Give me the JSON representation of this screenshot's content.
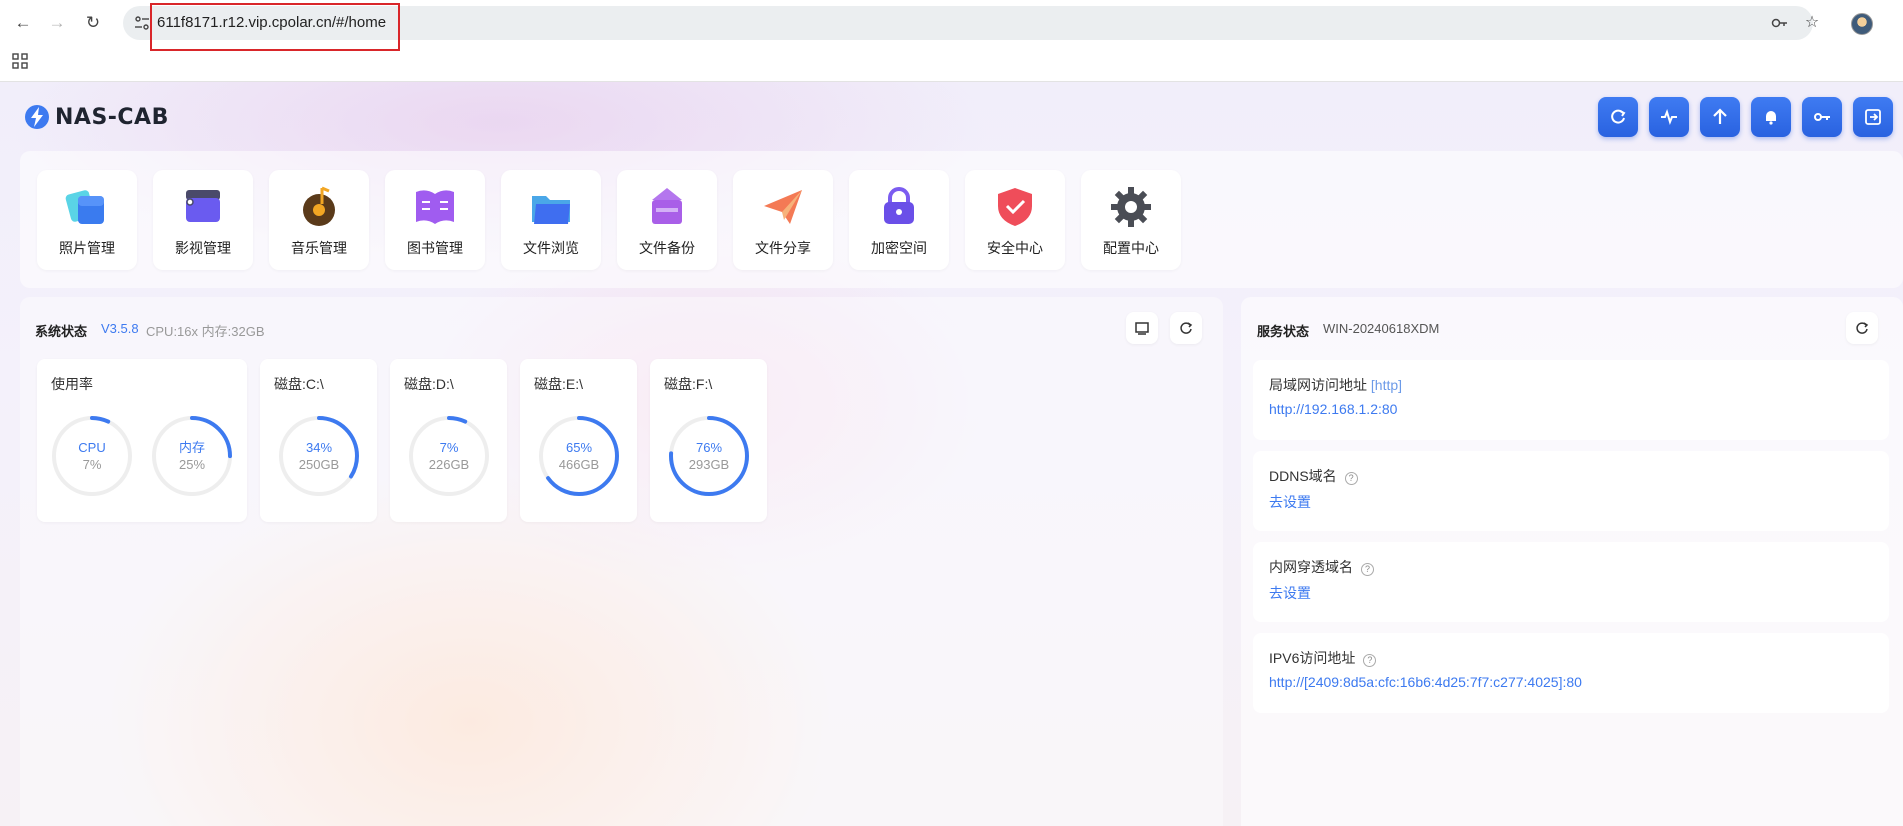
{
  "browser": {
    "url": "611f8171.r12.vip.cpolar.cn/#/home"
  },
  "app": {
    "logo_text": "NAS-CAB"
  },
  "apps": [
    {
      "label": "照片管理",
      "icon": "photo-icon"
    },
    {
      "label": "影视管理",
      "icon": "video-icon"
    },
    {
      "label": "音乐管理",
      "icon": "music-icon"
    },
    {
      "label": "图书管理",
      "icon": "book-icon"
    },
    {
      "label": "文件浏览",
      "icon": "folder-icon"
    },
    {
      "label": "文件备份",
      "icon": "backup-icon"
    },
    {
      "label": "文件分享",
      "icon": "share-icon"
    },
    {
      "label": "加密空间",
      "icon": "lock-icon"
    },
    {
      "label": "安全中心",
      "icon": "shield-icon"
    },
    {
      "label": "配置中心",
      "icon": "gear-icon"
    }
  ],
  "system": {
    "title": "系统状态",
    "version": "V3.5.8",
    "meta": "CPU:16x 内存:32GB",
    "usage_card": {
      "title": "使用率",
      "gauges": [
        {
          "label": "CPU",
          "value": "7%",
          "percent": 7
        },
        {
          "label": "内存",
          "value": "25%",
          "percent": 25
        }
      ]
    },
    "disks": [
      {
        "title": "磁盘:C:\\",
        "percent_label": "34%",
        "size": "250GB",
        "percent": 34
      },
      {
        "title": "磁盘:D:\\",
        "percent_label": "7%",
        "size": "226GB",
        "percent": 7
      },
      {
        "title": "磁盘:E:\\",
        "percent_label": "65%",
        "size": "466GB",
        "percent": 65
      },
      {
        "title": "磁盘:F:\\",
        "percent_label": "76%",
        "size": "293GB",
        "percent": 76
      }
    ]
  },
  "service": {
    "title": "服务状态",
    "host": "WIN-20240618XDM",
    "cards": [
      {
        "title": "局域网访问地址",
        "tag": "[http]",
        "value": "http://192.168.1.2:80",
        "help": false
      },
      {
        "title": "DDNS域名",
        "tag": "",
        "value": "去设置",
        "help": true
      },
      {
        "title": "内网穿透域名",
        "tag": "",
        "value": "去设置",
        "help": true
      },
      {
        "title": "IPV6访问地址",
        "tag": "",
        "value": "http://[2409:8d5a:cfc:16b6:4d25:7f7:c277:4025]:80",
        "help": true
      }
    ]
  },
  "colors": {
    "accent": "#3d7af0",
    "gauge_track": "#eeeeee",
    "highlight": "#d9262a"
  }
}
